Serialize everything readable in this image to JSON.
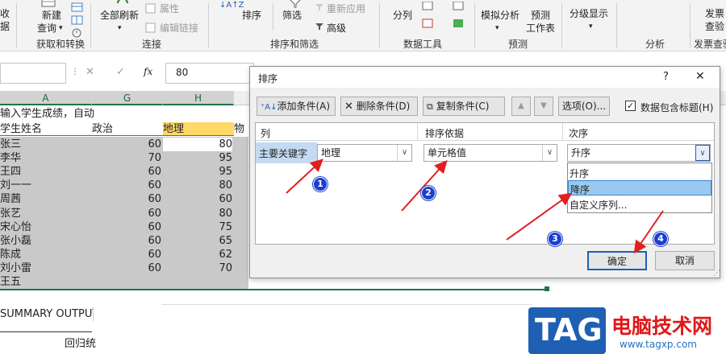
{
  "ribbon": {
    "new_query": "新建",
    "new_query_2": "查询",
    "data_1": "收",
    "data_2": "据",
    "refresh_all": "全部刷新",
    "properties": "属性",
    "edit_links": "编辑链接",
    "sort": "排序",
    "filter": "筛选",
    "reapply": "重新应用",
    "advanced": "高级",
    "text_to_columns": "分列",
    "what_if": "模拟分析",
    "forecast_sheet": "预测",
    "forecast_sheet_2": "工作表",
    "outline": "分级显示",
    "invoice_check": "发票",
    "invoice_check_2": "查验",
    "groups": {
      "get_transform": "获取和转换",
      "connections": "连接",
      "sort_filter": "排序和筛选",
      "data_tools": "数据工具",
      "forecast": "预测",
      "analysis": "分析",
      "invoice": "发票查验"
    }
  },
  "formula_bar": {
    "fx": "fx",
    "value": "80"
  },
  "sheet": {
    "columns": [
      "A",
      "G",
      "H"
    ],
    "banner": "输入学生成绩，自动",
    "header_a": "学生姓名",
    "header_g": "政治",
    "header_h": "地理",
    "header_i": "物",
    "names": [
      "张三",
      "李华",
      "王四",
      "刘一一",
      "周茜",
      "张艺",
      "宋心怡",
      "张小磊",
      "陈成",
      "刘小雷",
      "王五"
    ],
    "g_values": [
      "60",
      "70",
      "60",
      "60",
      "60",
      "60",
      "60",
      "60",
      "60",
      "60"
    ],
    "h_values": [
      "80",
      "95",
      "95",
      "80",
      "60",
      "80",
      "75",
      "65",
      "62",
      "70"
    ],
    "summary": "SUMMARY OUTPUT",
    "regression": "回归统"
  },
  "dialog": {
    "title": "排序",
    "help": "?",
    "close": "✕",
    "add_level": "添加条件(A)",
    "delete_level": "删除条件(D)",
    "copy_level": "复制条件(C)",
    "options": "选项(O)...",
    "has_headers": "数据包含标题(H)",
    "has_headers_checked": true,
    "col_header": "列",
    "sort_on_header": "排序依据",
    "order_header": "次序",
    "primary_key": "主要关键字",
    "column_value": "地理",
    "sort_on_value": "单元格值",
    "order_value": "升序",
    "order_options": [
      "升序",
      "降序",
      "自定义序列..."
    ],
    "order_highlighted": "降序",
    "ok": "确定",
    "cancel": "取消"
  },
  "annotations": {
    "markers": [
      "1",
      "2",
      "3",
      "4"
    ],
    "arrow_color": "#e02020",
    "marker_color": "#1c3fd0"
  },
  "watermark": {
    "logo": "TAG",
    "site_name": "电脑技术网",
    "url": "www.tagxp.com",
    "logo_bg": "#1f5fb4",
    "site_color": "#e01818"
  },
  "colors": {
    "excel_green": "#217346",
    "selection_blue": "#99c9ef",
    "cell_grey": "#c9c9c9",
    "header_yellow": "#ffd966"
  }
}
